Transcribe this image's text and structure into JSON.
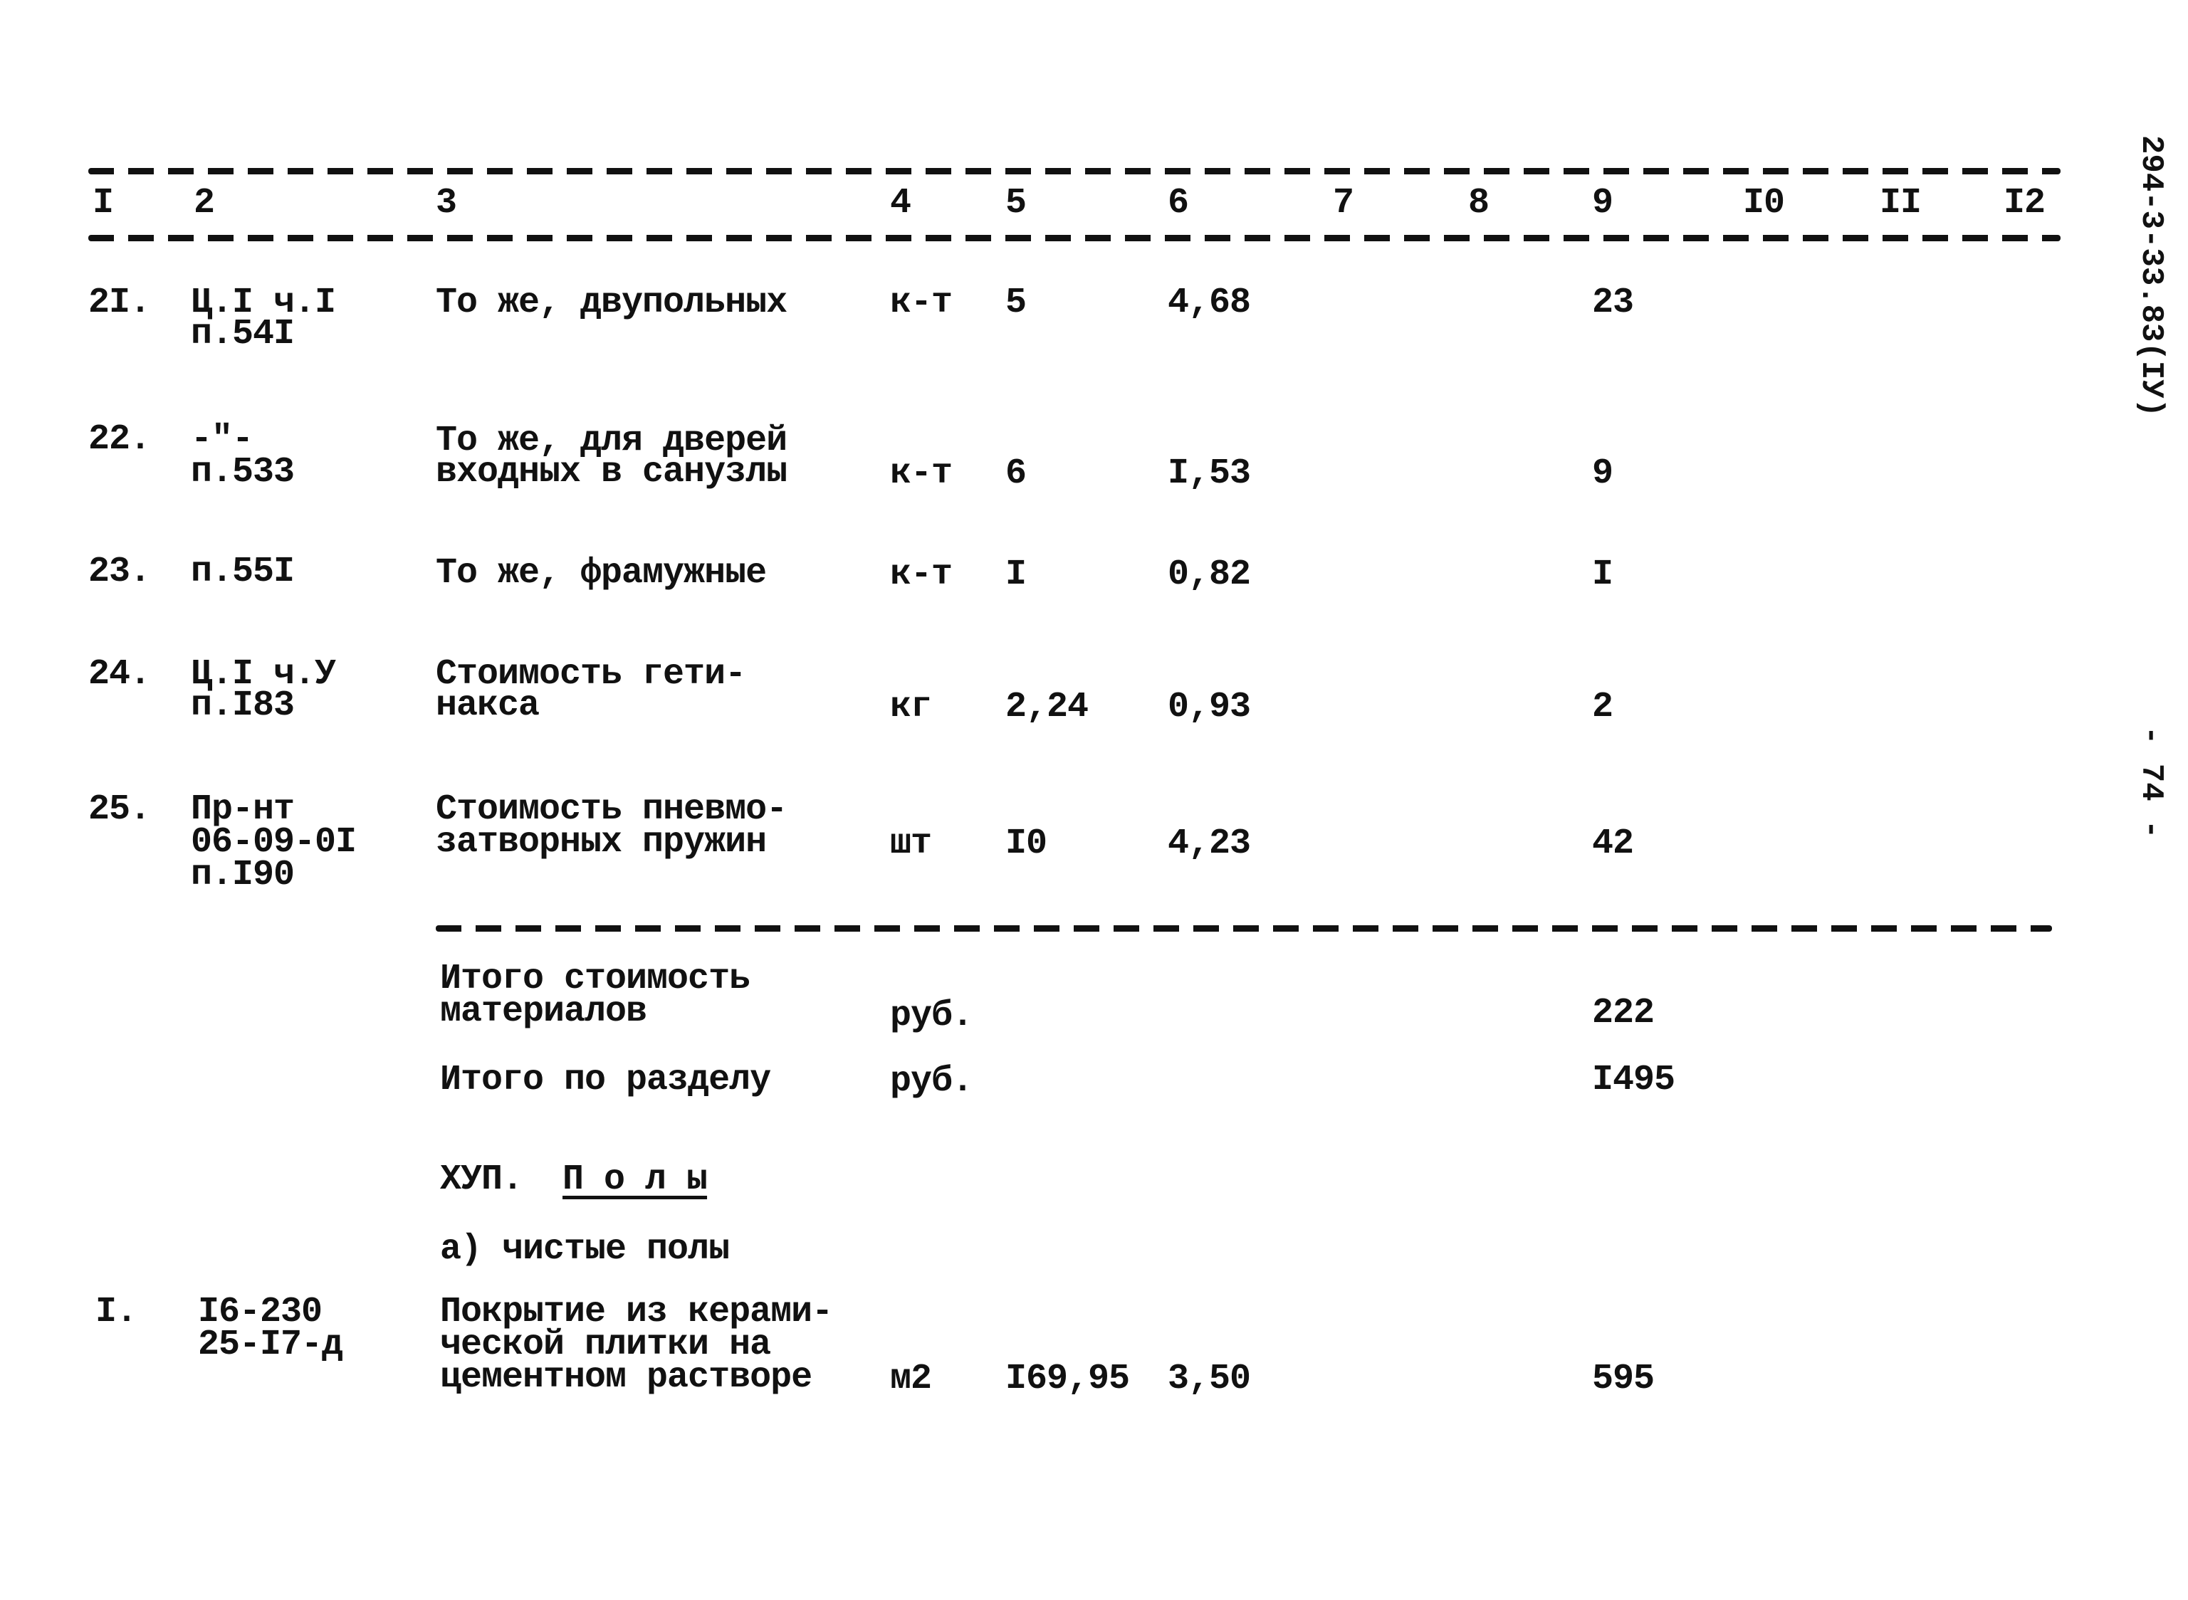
{
  "document": {
    "side_code": "294-3-33.83(IУ)",
    "page_number": "- 74 -"
  },
  "header": {
    "columns": [
      "I",
      "2",
      "3",
      "4",
      "5",
      "6",
      "7",
      "8",
      "9",
      "I0",
      "II",
      "I2"
    ]
  },
  "rows": [
    {
      "num": "2I.",
      "ref": [
        "Ц.I ч.I",
        "п.54I"
      ],
      "desc": [
        "То же, двупольных"
      ],
      "unit": "к-т",
      "qty": "5",
      "price": "4,68",
      "total": "23"
    },
    {
      "num": "22.",
      "ref": [
        "-\"-",
        "п.533"
      ],
      "desc": [
        "То же, для дверей",
        "входных в санузлы"
      ],
      "unit": "к-т",
      "qty": "6",
      "price": "I,53",
      "total": "9"
    },
    {
      "num": "23.",
      "ref": [
        "п.55I"
      ],
      "desc": [
        "То же, фрамужные"
      ],
      "unit": "к-т",
      "qty": "I",
      "price": "0,82",
      "total": "I"
    },
    {
      "num": "24.",
      "ref": [
        "Ц.I ч.У",
        "п.I83"
      ],
      "desc": [
        "Стоимость гети-",
        "накса"
      ],
      "unit": "кг",
      "qty": "2,24",
      "price": "0,93",
      "total": "2"
    },
    {
      "num": "25.",
      "ref": [
        "Пр-нт",
        "06-09-0I",
        "п.I90"
      ],
      "desc": [
        "Стоимость пневмо-",
        "затворных пружин"
      ],
      "unit": "шт",
      "qty": "I0",
      "price": "4,23",
      "total": "42"
    }
  ],
  "totals": [
    {
      "label": [
        "Итого стоимость",
        "материалов"
      ],
      "unit": "руб.",
      "total": "222"
    },
    {
      "label": [
        "Итого по разделу"
      ],
      "unit": "руб.",
      "total": "I495"
    }
  ],
  "section": {
    "number": "ХУП.",
    "title": "П о л ы",
    "subsection": "а) чистые полы"
  },
  "section_rows": [
    {
      "num": "I.",
      "ref": [
        "I6-230",
        "25-I7-д"
      ],
      "desc": [
        "Покрытие из керами-",
        "ческой плитки на",
        "цементном растворе"
      ],
      "unit": "м2",
      "qty": "I69,95",
      "price": "3,50",
      "total": "595"
    }
  ]
}
